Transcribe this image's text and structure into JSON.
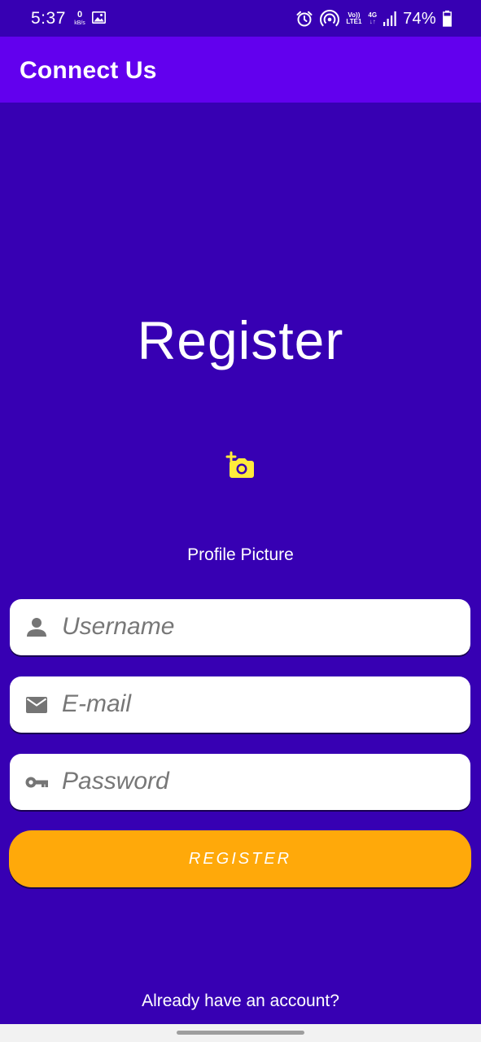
{
  "status_bar": {
    "time": "5:37",
    "net_speed_value": "0",
    "net_speed_unit": "kB/s",
    "volte_line1": "Vo))",
    "volte_line2": "LTE1",
    "network_type": "4G",
    "battery": "74%",
    "icons": [
      "gallery-icon",
      "alarm-icon",
      "hotspot-icon",
      "volte-icon",
      "data-arrows-icon",
      "signal-icon",
      "battery-icon"
    ]
  },
  "app_bar": {
    "title": "Connect Us",
    "color": "#6200EE"
  },
  "form": {
    "heading": "Register",
    "profile_picture_label": "Profile Picture",
    "camera_icon": "add-a-photo-icon",
    "camera_icon_color": "#FFEB3B",
    "username_placeholder": "Username",
    "email_placeholder": "E-mail",
    "password_placeholder": "Password",
    "username_value": "",
    "email_value": "",
    "password_value": "",
    "field_icons": [
      "person-icon",
      "mail-icon",
      "key-icon"
    ],
    "register_button_label": "REGISTER",
    "register_button_color": "#FFA90A",
    "login_link_label": "Already have an account?"
  },
  "theme": {
    "background": "#3700B3",
    "text": "#FFFFFF"
  }
}
